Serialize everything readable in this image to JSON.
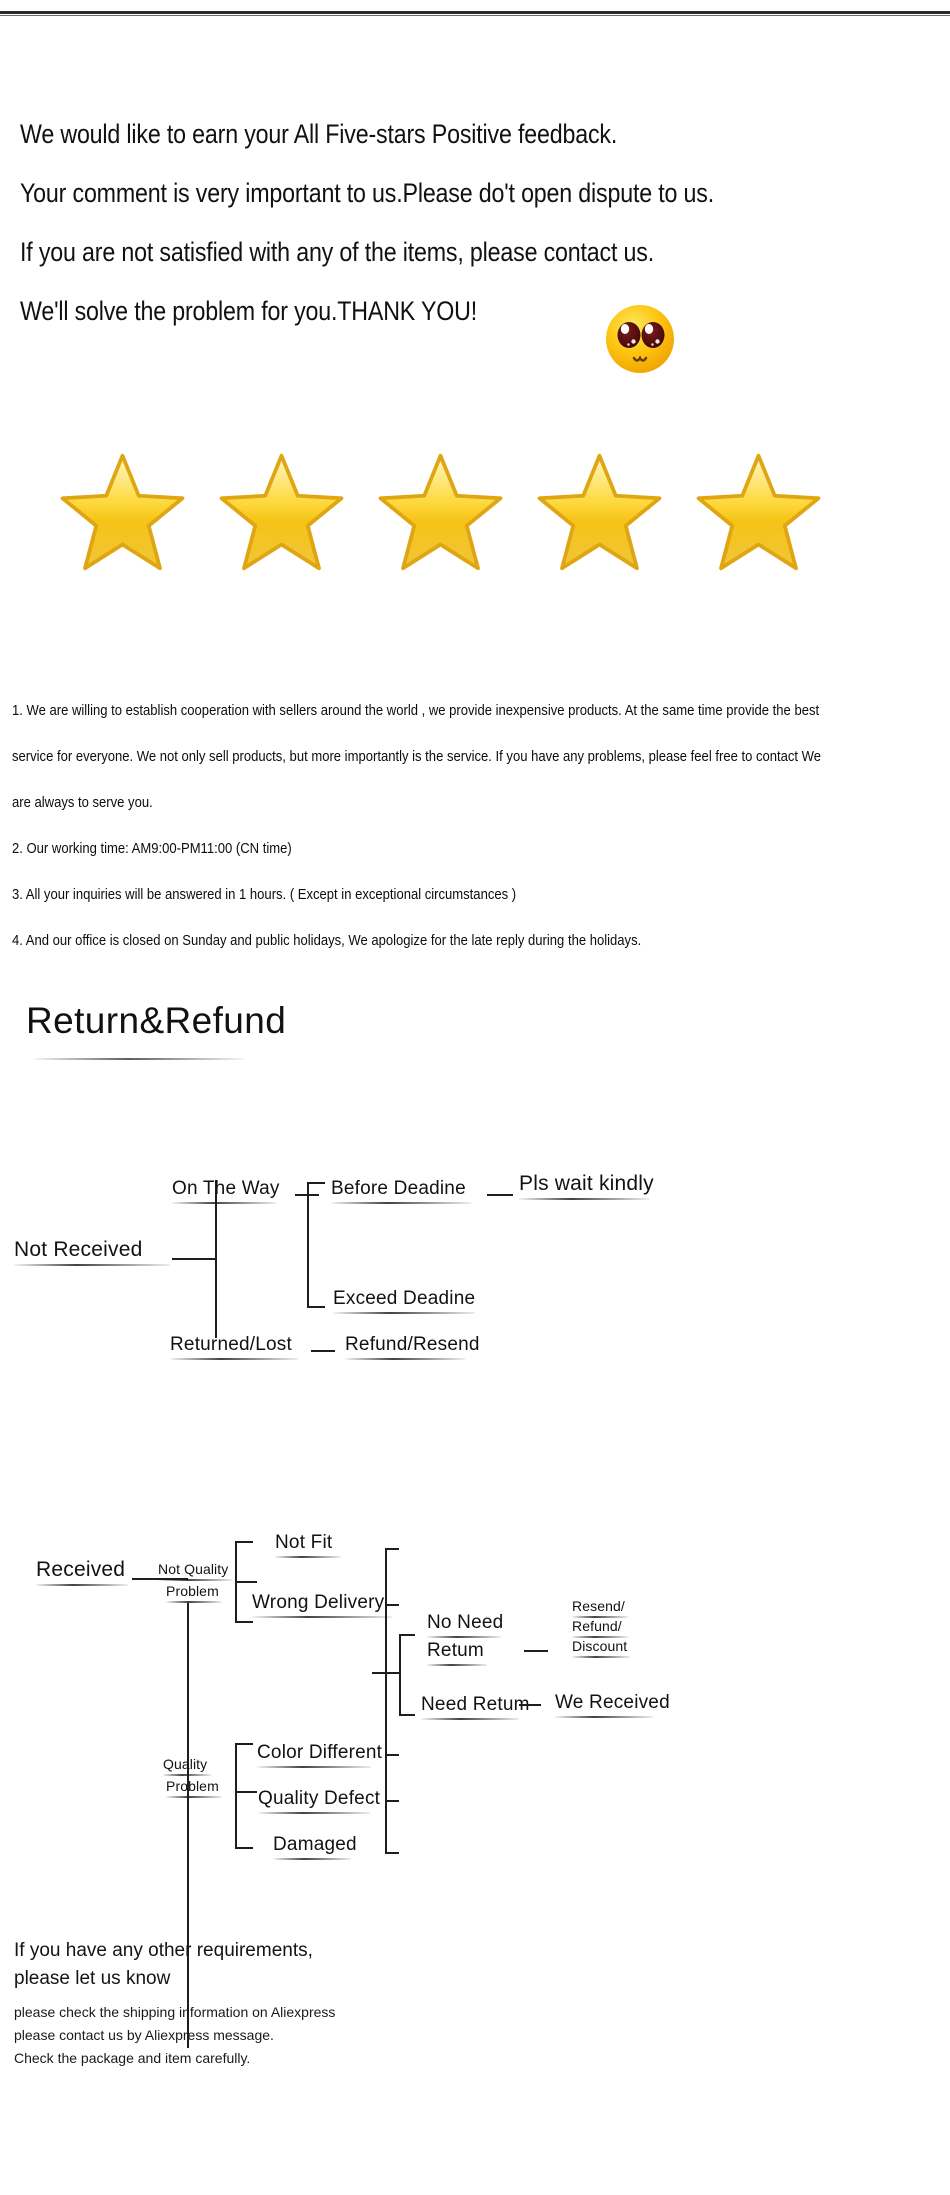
{
  "meta": {
    "background_color": "#ffffff",
    "rule_color": "#2b2b2b",
    "text_color": "#121212",
    "star_color": "#f5c60a",
    "star_outline_color": "#d99a13"
  },
  "headline": {
    "lines": [
      "We would like to earn your All Five-stars Positive feedback.",
      "Your comment is very important to us.Please do't open dispute to us.",
      "If you are not satisfied with any of the items, please contact us.",
      "We'll solve the problem for you.THANK YOU!"
    ],
    "emoji": "star-eyes-face-emoji"
  },
  "rating": {
    "star_count": 5,
    "icon": "star-icon"
  },
  "service_notes": [
    "1. We are willing to establish cooperation with sellers around the world , we provide inexpensive products. At the same time provide the best",
    "service for everyone. We not only sell products, but more importantly is the service. If you have any problems, please feel free to contact We",
    "are always to serve you.",
    "2. Our working time: AM9:00-PM11:00 (CN time)",
    "3. All your inquiries will be answered in 1 hours. ( Except in exceptional circumstances )",
    "4. And our office is closed on Sunday and public holidays, We apologize for the late reply during the holidays."
  ],
  "return_refund": {
    "title": "Return&Refund"
  },
  "flow_not_received": {
    "root": "Not   Received",
    "branch_1": "On The Way",
    "branch_2": "Returned/Lost",
    "on_the_way_children": [
      "Before Deadine",
      "Exceed Deadine"
    ],
    "before_deadine_result": "Pls wait kindly",
    "returned_lost_result": "Refund/Resend"
  },
  "flow_received": {
    "root": "Received",
    "branch_not_quality_l1": "Not Quality",
    "branch_not_quality_l2": "Problem",
    "branch_quality_l1": "Quality",
    "branch_quality_l2": "Problem",
    "not_quality_children": [
      "Not Fit",
      "Wrong Delivery"
    ],
    "quality_children": [
      "Color Different",
      "Quality Defect",
      "Damaged"
    ],
    "outcome_no_need_l1": "No Need",
    "outcome_no_need_l2": "Retum",
    "outcome_need_return": "Need Retum",
    "result_no_need_l1": "Resend/",
    "result_no_need_l2": "Refund/",
    "result_no_need_l3": "Discount",
    "result_need_return": "We Received"
  },
  "footer": {
    "line_1": "If you have any other requirements,",
    "line_2": " please let us know",
    "line_3": "please check the shipping information on Aliexpress",
    "line_4": "please contact us by Aliexpress message.",
    "line_5": "Check the package and item carefully."
  }
}
